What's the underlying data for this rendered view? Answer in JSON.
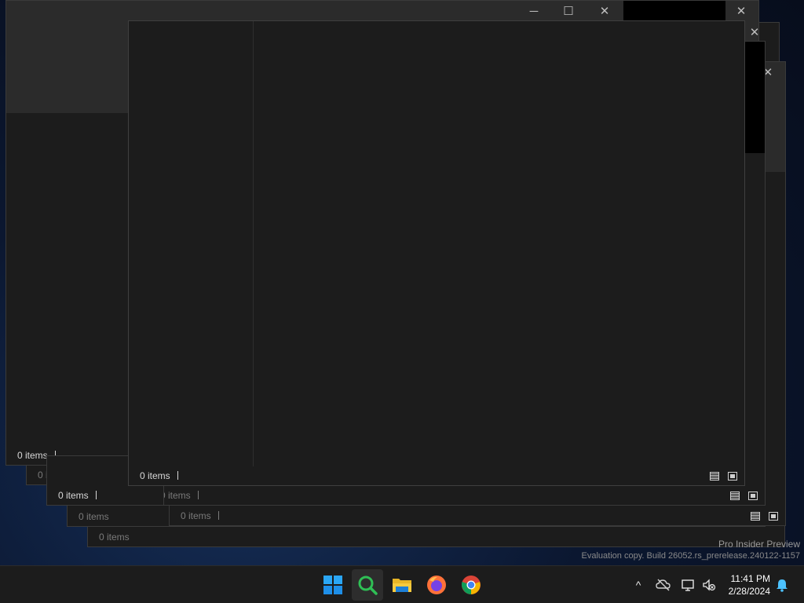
{
  "window": {
    "caption_minimize": "─",
    "caption_maximize": "☐",
    "caption_close": "✕"
  },
  "windows": [
    {
      "status_text": "0 items"
    },
    {
      "status_text": "0 items"
    },
    {
      "status_text": "0 items"
    },
    {
      "status_text": "0 items"
    },
    {
      "status_text": "0 items"
    },
    {
      "status_text": "0 items"
    },
    {
      "status_text": "0 items"
    }
  ],
  "watermark": {
    "line1": "Pro Insider Preview",
    "line2": "Evaluation copy. Build 26052.rs_prerelease.240122-1157"
  },
  "taskbar": {
    "apps": [
      {
        "name": "start-icon"
      },
      {
        "name": "search-magnifier-icon"
      },
      {
        "name": "file-explorer-icon"
      },
      {
        "name": "firefox-icon"
      },
      {
        "name": "chrome-icon"
      }
    ],
    "tray": {
      "chevron": "^",
      "time": "11:41 PM",
      "date": "2/28/2024"
    }
  },
  "colors": {
    "window_bg": "#1c1c1c",
    "title_bg": "#2b2b2b",
    "taskbar_bg": "#1c1c1c",
    "accent_blue": "#0f8ff0",
    "search_green": "#2fbf55"
  }
}
